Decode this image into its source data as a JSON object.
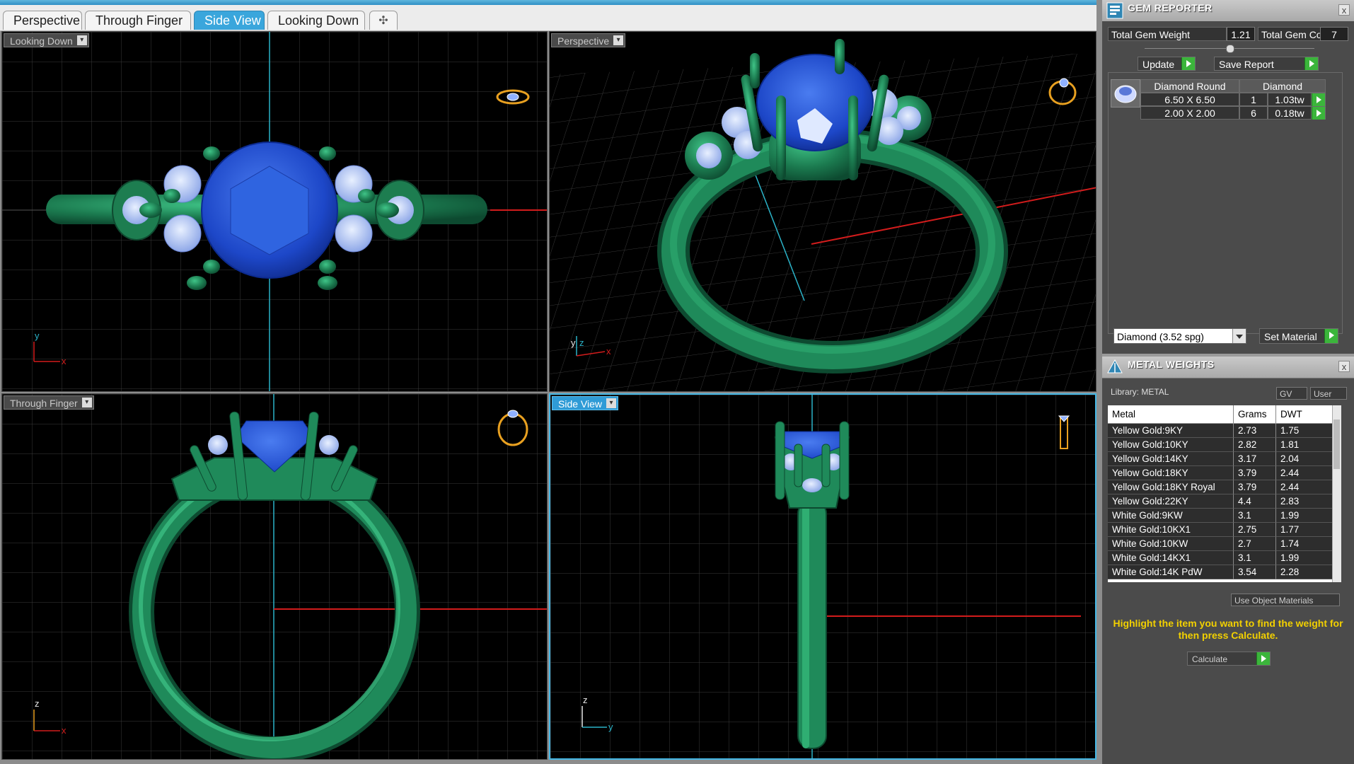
{
  "tabs": [
    {
      "label": "Perspective",
      "active": false
    },
    {
      "label": "Through Finger",
      "active": false
    },
    {
      "label": "Side View",
      "active": true
    },
    {
      "label": "Looking Down",
      "active": false
    }
  ],
  "add_tab_glyph": "✣",
  "viewports": {
    "top_left": {
      "label": "Looking Down",
      "axis_a": "y",
      "axis_b": "x"
    },
    "top_right": {
      "label": "Perspective",
      "axis_a": "z",
      "axis_b": "x",
      "axis_c": "y"
    },
    "bottom_left": {
      "label": "Through Finger",
      "axis_a": "z",
      "axis_b": "x"
    },
    "bottom_right": {
      "label": "Side View",
      "axis_a": "z",
      "axis_b": "y"
    }
  },
  "gem_reporter": {
    "title": "GEM REPORTER",
    "close": "x",
    "total_weight_label": "Total Gem Weight",
    "total_weight_value": "1.21",
    "total_count_label": "Total Gem Count",
    "total_count_value": "7",
    "update_label": "Update",
    "save_report_label": "Save Report",
    "table_headers": [
      "Diamond Round",
      "Diamond"
    ],
    "rows": [
      {
        "size": "6.50 X 6.50",
        "qty": "1",
        "weight": "1.03tw"
      },
      {
        "size": "2.00 X 2.00",
        "qty": "6",
        "weight": "0.18tw"
      }
    ],
    "material_select": "Diamond     (3.52 spg)",
    "set_material_label": "Set Material"
  },
  "metal_weights": {
    "title": "METAL WEIGHTS",
    "close": "x",
    "library": "Library: METAL",
    "gv_label": "GV",
    "user_label": "User",
    "headers": [
      "Metal",
      "Grams",
      "DWT"
    ],
    "rows": [
      {
        "metal": "Yellow Gold:9KY",
        "grams": "2.73",
        "dwt": "1.75"
      },
      {
        "metal": "Yellow Gold:10KY",
        "grams": "2.82",
        "dwt": "1.81"
      },
      {
        "metal": "Yellow Gold:14KY",
        "grams": "3.17",
        "dwt": "2.04"
      },
      {
        "metal": "Yellow Gold:18KY",
        "grams": "3.79",
        "dwt": "2.44"
      },
      {
        "metal": "Yellow Gold:18KY Royal",
        "grams": "3.79",
        "dwt": "2.44"
      },
      {
        "metal": "Yellow Gold:22KY",
        "grams": "4.4",
        "dwt": "2.83"
      },
      {
        "metal": "White Gold:9KW",
        "grams": "3.1",
        "dwt": "1.99"
      },
      {
        "metal": "White Gold:10KX1",
        "grams": "2.75",
        "dwt": "1.77"
      },
      {
        "metal": "White Gold:10KW",
        "grams": "2.7",
        "dwt": "1.74"
      },
      {
        "metal": "White Gold:14KX1",
        "grams": "3.1",
        "dwt": "1.99"
      },
      {
        "metal": "White Gold:14K PdW",
        "grams": "3.54",
        "dwt": "2.28"
      }
    ],
    "use_object_materials": "Use Object Materials",
    "hint": "Highlight the item you want to find the weight for then press Calculate.",
    "calculate_label": "Calculate"
  },
  "colors": {
    "metal": "#1f8a5a",
    "gem": "#1d47c8",
    "accent": "#3aa6dc",
    "hint": "#f2d000"
  }
}
